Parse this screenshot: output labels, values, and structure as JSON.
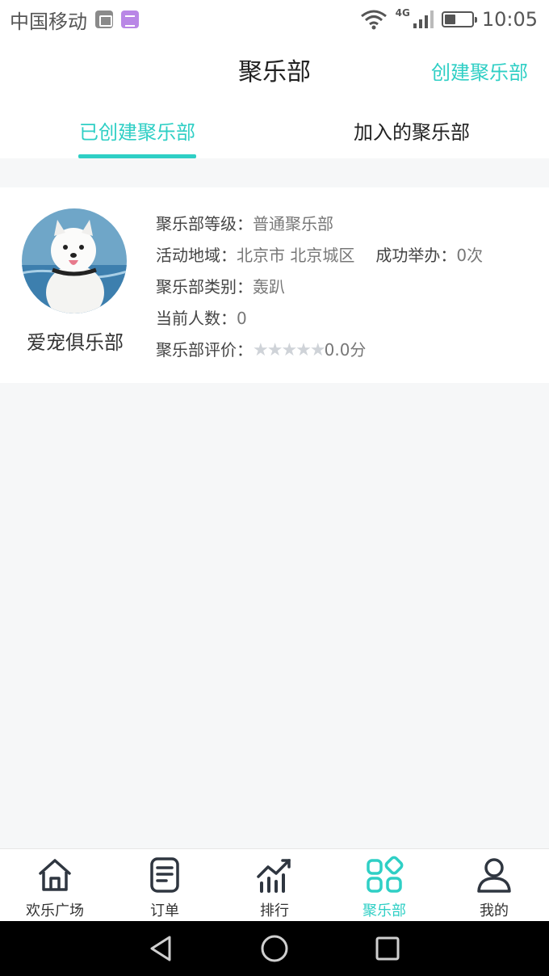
{
  "status_bar": {
    "carrier": "中国移动",
    "network": "4G",
    "time": "10:05",
    "battery_level": 0.4,
    "icons": [
      "gallery-icon",
      "note-icon",
      "wifi-icon",
      "signal-icon",
      "battery-icon"
    ]
  },
  "header": {
    "title": "聚乐部",
    "action_label": "创建聚乐部"
  },
  "tabs": [
    {
      "label": "已创建聚乐部",
      "active": true
    },
    {
      "label": "加入的聚乐部",
      "active": false
    }
  ],
  "club": {
    "name": "爱宠俱乐部",
    "level_label": "聚乐部等级：",
    "level_value": "普通聚乐部",
    "region_label": "活动地域：",
    "region_value": "北京市 北京城区",
    "hosted_label": "成功举办：",
    "hosted_value": "0次",
    "category_label": "聚乐部类别：",
    "category_value": "轰趴",
    "members_label": "当前人数：",
    "members_value": "0",
    "rating_label": "聚乐部评价：",
    "rating_stars": "★★★★★",
    "rating_value": "0.0分",
    "rating": 0
  },
  "bottom_nav": [
    {
      "label": "欢乐广场",
      "icon": "home-icon",
      "active": false
    },
    {
      "label": "订单",
      "icon": "order-icon",
      "active": false
    },
    {
      "label": "排行",
      "icon": "ranking-icon",
      "active": false
    },
    {
      "label": "聚乐部",
      "icon": "club-icon",
      "active": true
    },
    {
      "label": "我的",
      "icon": "profile-icon",
      "active": false
    }
  ],
  "colors": {
    "accent": "#2fcfc5",
    "background": "#f6f7f8",
    "star_inactive": "#cfd3d8"
  }
}
